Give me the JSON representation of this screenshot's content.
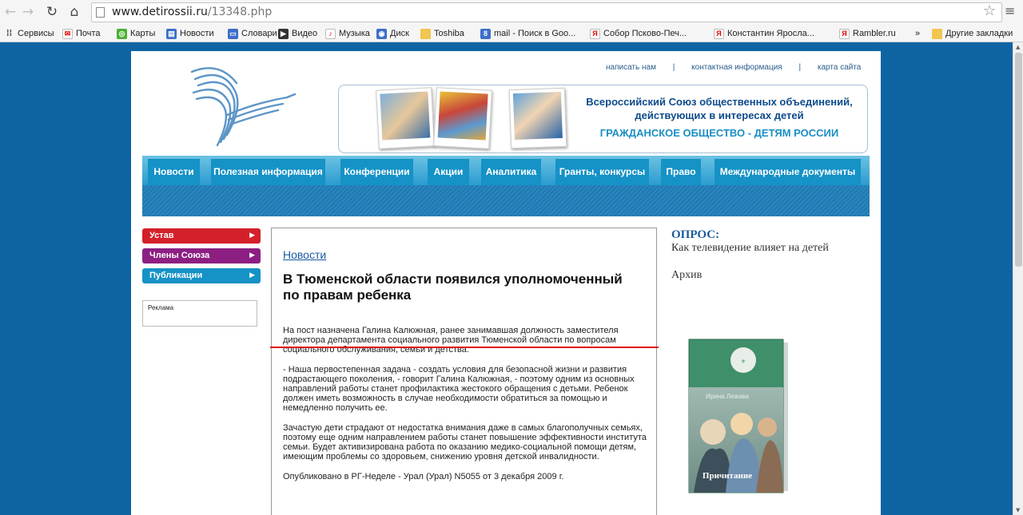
{
  "browser": {
    "url_domain": "www.detirossii.ru",
    "url_path": "/13348.php",
    "bookmarks": [
      {
        "label": "Сервисы",
        "icon": "apps-icon"
      },
      {
        "label": "Почта",
        "icon": "yandex-mail-icon"
      },
      {
        "label": "Карты",
        "icon": "maps-icon"
      },
      {
        "label": "Новости",
        "icon": "news-icon"
      },
      {
        "label": "Словари",
        "icon": "dictionary-icon"
      },
      {
        "label": "Видео",
        "icon": "video-icon"
      },
      {
        "label": "Музыка",
        "icon": "music-icon"
      },
      {
        "label": "Диск",
        "icon": "disk-icon"
      },
      {
        "label": "Toshiba",
        "icon": "folder-icon"
      },
      {
        "label": "mail - Поиск в Goo...",
        "icon": "google-icon"
      },
      {
        "label": "Собор Псково-Печ...",
        "icon": "yandex-icon"
      },
      {
        "label": "Константин Яросла...",
        "icon": "yandex-icon"
      },
      {
        "label": "Rambler.ru",
        "icon": "yandex-icon"
      },
      {
        "label": "»",
        "icon": ""
      },
      {
        "label": "Другие закладки",
        "icon": "folder-icon"
      }
    ]
  },
  "header": {
    "links": [
      "написать нам",
      "контактная информация",
      "карта сайта"
    ],
    "separator": "|",
    "org_name": "Всероссийский Союз общественных объединений, действующих в интересах детей",
    "slogan": "ГРАЖДАНСКОЕ ОБЩЕСТВО - ДЕТЯМ РОССИИ"
  },
  "nav": [
    "Новости",
    "Полезная информация",
    "Конференции",
    "Акции",
    "Аналитика",
    "Гранты, конкурсы",
    "Право",
    "Международные документы"
  ],
  "sidebar": {
    "buttons": [
      {
        "label": "Устав",
        "color": "#d4202a"
      },
      {
        "label": "Члены Союза",
        "color": "#8d1f82"
      },
      {
        "label": "Публикации",
        "color": "#1592c6"
      }
    ],
    "ad_label": "Реклама"
  },
  "article": {
    "category": "Новости",
    "title": "В Тюменской области появился уполномоченный по правам ребенка",
    "paragraphs": [
      "На пост назначена Галина Калюжная, ранее занимавшая должность заместителя директора департамента социального развития Тюменской области по вопросам социального обслуживания, семьи и детства.",
      "- Наша первостепенная задача - создать условия для безопасной жизни и развития подрастающего поколения, - говорит Галина Калюжная, - поэтому одним из основных направлений работы станет профилактика жестокого обращения с детьми. Ребенок должен иметь возможность в случае необходимости обратиться за помощью и немедленно получить ее.",
      "Зачастую дети страдают от недостатка внимания даже в самых благополучных семьях, поэтому еще одним направлением работы станет повышение эффективности института семьи. Будет активизирована работа по оказанию медико-социальной помощи детям, имеющим проблемы со здоровьем, снижению уровня детской инвалидности.",
      "Опубликовано в РГ-Неделе - Урал (Урал) N5055 от 3 декабря 2009 г."
    ]
  },
  "poll": {
    "title": "ОПРОС:",
    "question": "Как телевидение влияет на детей",
    "archive": "Архив"
  },
  "book": {
    "author": "Ирина Лежава",
    "title": "Причитание"
  },
  "colors": {
    "page_bg": "#0e64a2",
    "nav_bg": "#1592c6",
    "annotation_line": "#e01010"
  }
}
